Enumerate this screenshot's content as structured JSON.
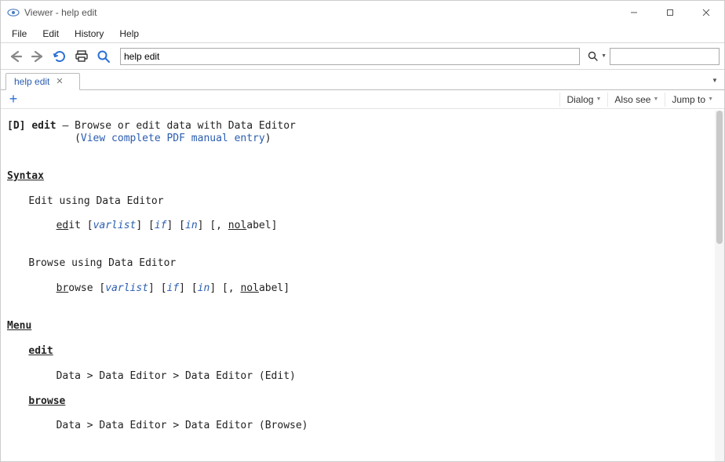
{
  "window": {
    "title": "Viewer - help edit"
  },
  "menus": {
    "file": "File",
    "edit": "Edit",
    "history": "History",
    "help": "Help"
  },
  "toolbar": {
    "command_value": "help edit",
    "search_placeholder": ""
  },
  "tab": {
    "label": "help edit"
  },
  "dropdowns": {
    "dialog": "Dialog",
    "alsosee": "Also see",
    "jumpto": "Jump to"
  },
  "help": {
    "tag": "[D]",
    "cmd": "edit",
    "dash": "—",
    "desc": "Browse or edit data with Data Editor",
    "pdf_open": "(",
    "pdf_link": "View complete PDF manual entry",
    "pdf_close": ")",
    "syntax_heading": "Syntax",
    "edit_using": "Edit using Data Editor",
    "edit_line": {
      "ed": "ed",
      "it": "it ",
      "ob1": "[",
      "varlist": "varlist",
      "cb1": "] ",
      "ob2": "[",
      "if": "if",
      "cb2": "] ",
      "ob3": "[",
      "in": "in",
      "cb3": "] ",
      "ob4": "[, ",
      "nol": "nol",
      "abel": "abel",
      "cb4": "]"
    },
    "browse_using": "Browse using Data Editor",
    "browse_line": {
      "br": "br",
      "owse": "owse ",
      "ob1": "[",
      "varlist": "varlist",
      "cb1": "] ",
      "ob2": "[",
      "if": "if",
      "cb2": "] ",
      "ob3": "[",
      "in": "in",
      "cb3": "] ",
      "ob4": "[, ",
      "nol": "nol",
      "abel": "abel",
      "cb4": "]"
    },
    "menu_heading": "Menu",
    "edit_subhead": "edit",
    "edit_menu_path": "Data > Data Editor > Data Editor (Edit)",
    "browse_subhead": "browse",
    "browse_menu_path": "Data > Data Editor > Data Editor (Browse)"
  }
}
